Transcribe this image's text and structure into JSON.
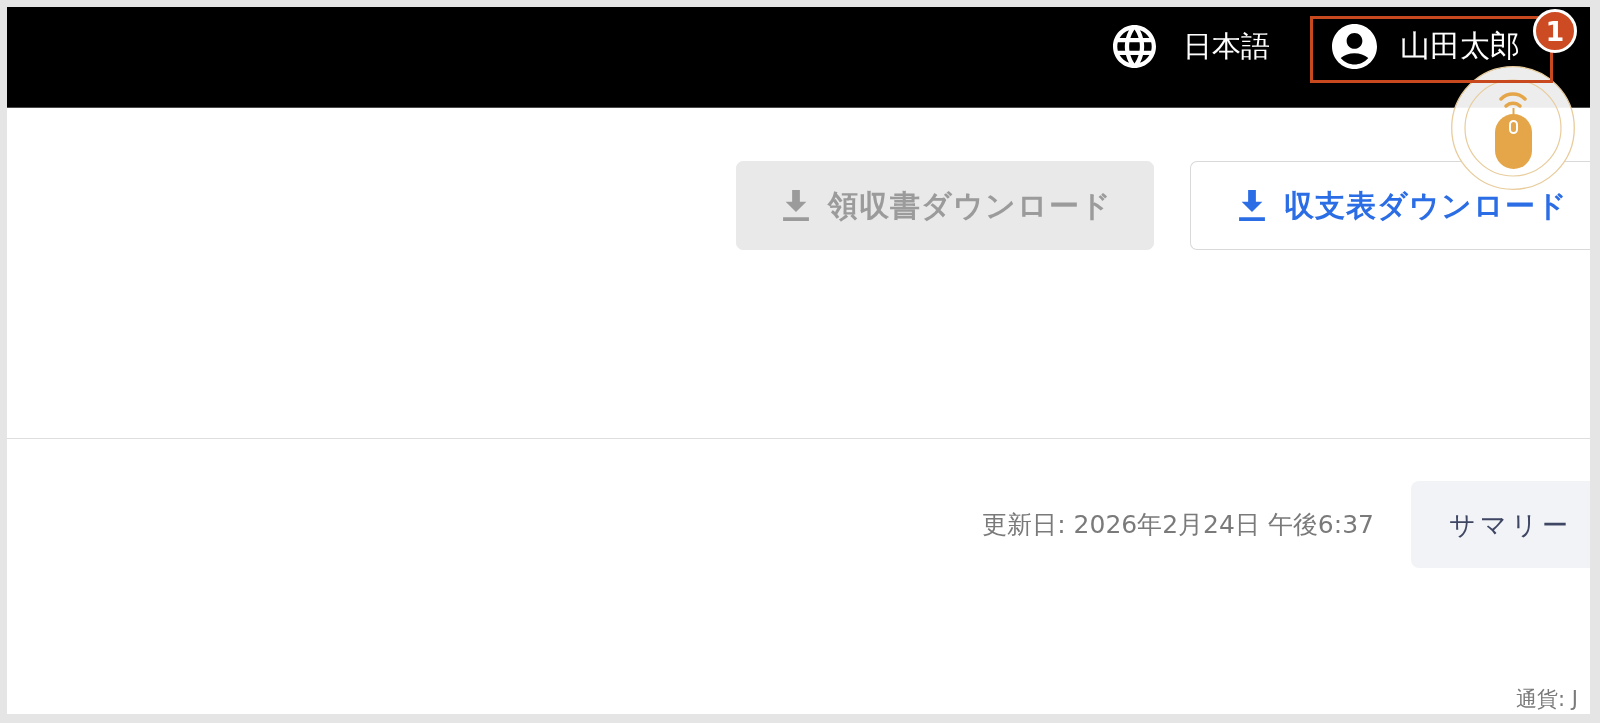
{
  "header": {
    "language": "日本語",
    "user_name": "山田太郎"
  },
  "annotation": {
    "step": "1",
    "highlighted": true,
    "click_indicator": true
  },
  "actions": [
    {
      "label": "領収書ダウンロード",
      "disabled": true
    },
    {
      "label": "収支表ダウンロード",
      "disabled": false
    }
  ],
  "info_bar": {
    "updated": "更新日: 2026年2月24日 午後6:37",
    "summary_button": "サマリー"
  },
  "footer": {
    "currency": "通貨: J"
  }
}
